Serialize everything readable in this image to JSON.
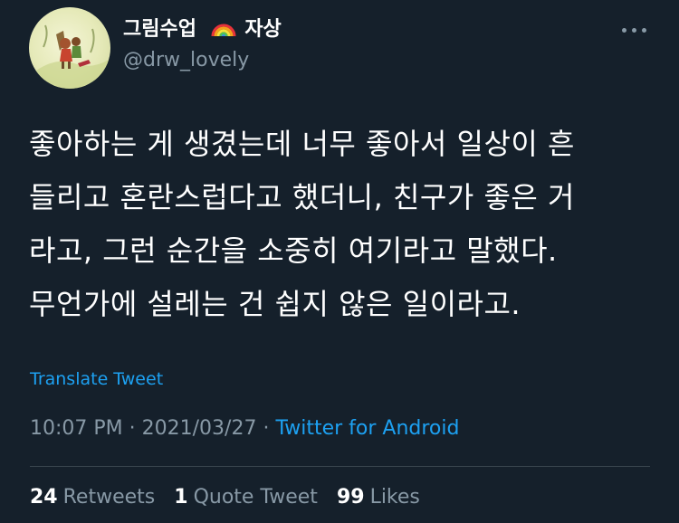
{
  "author": {
    "display_name": "그림수업",
    "display_name_suffix": "자상",
    "username": "@drw_lovely",
    "avatar_icon": "illustrated-children-avatar",
    "badge_icon": "rainbow-emoji"
  },
  "tweet": {
    "lines": [
      "좋아하는 게 생겼는데 너무 좋아서 일상이 흔",
      "들리고 혼란스럽다고 했더니, 친구가 좋은 거",
      "라고, 그런 순간을 소중히 여기라고 말했다.",
      "무언가에 설레는 건 쉽지 않은 일이라고."
    ]
  },
  "translate_label": "Translate Tweet",
  "meta": {
    "time": "10:07 PM",
    "separator": " · ",
    "date": "2021/03/27",
    "source": "Twitter for Android"
  },
  "stats": {
    "retweets_count": "24",
    "retweets_label": "Retweets",
    "quotes_count": "1",
    "quotes_label": "Quote Tweet",
    "likes_count": "99",
    "likes_label": "Likes"
  },
  "colors": {
    "background": "#15202b",
    "text": "#ffffff",
    "secondary": "#8899a6",
    "link": "#1da1f2",
    "divider": "#38444d"
  }
}
